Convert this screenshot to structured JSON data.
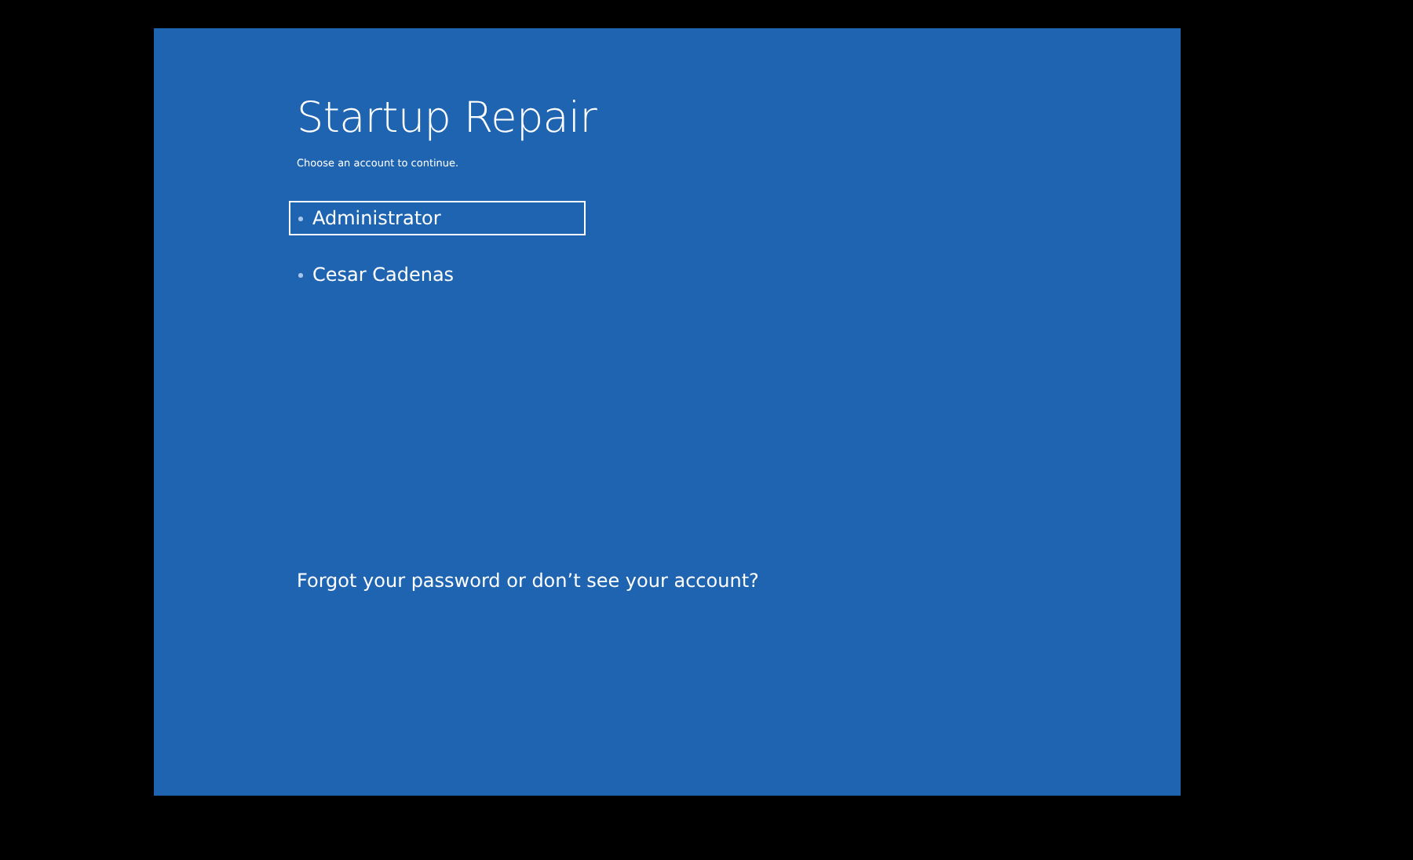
{
  "screen": {
    "title": "Startup Repair",
    "subtitle": "Choose an account to continue."
  },
  "accounts": [
    {
      "name": "Administrator",
      "selected": true
    },
    {
      "name": "Cesar Cadenas",
      "selected": false
    }
  ],
  "help_link": "Forgot your password or don’t see your account?"
}
